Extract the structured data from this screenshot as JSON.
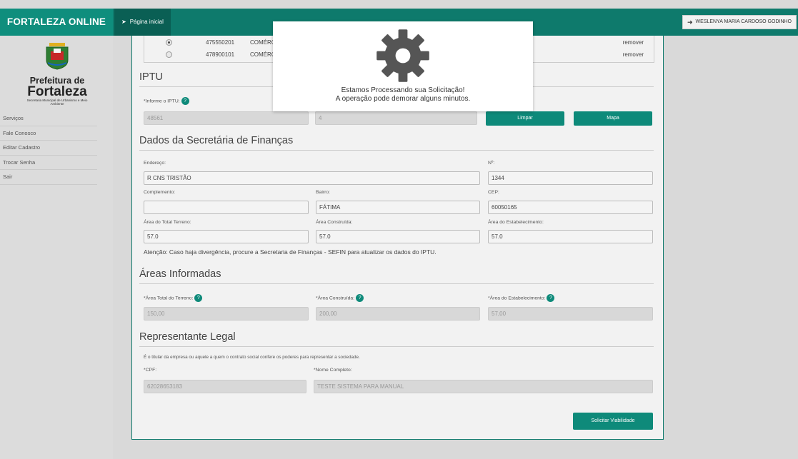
{
  "header": {
    "brand": "FORTALEZA ONLINE",
    "home_link": "Página inicial",
    "user_name": "WESLENYA MARIA CARDOSO GODINHO"
  },
  "sidebar": {
    "logo_line1": "Prefeitura de",
    "logo_line2": "Fortaleza",
    "logo_line3": "Secretaria Municipal de Urbanismo e Meio Ambiente",
    "items": [
      {
        "label": "Serviços"
      },
      {
        "label": "Fale Conosco"
      },
      {
        "label": "Editar Cadastro"
      },
      {
        "label": "Trocar Senha"
      },
      {
        "label": "Sair"
      }
    ]
  },
  "activity_rows": [
    {
      "code": "475550201",
      "desc": "COMÉRC",
      "action": "remover",
      "selected": true
    },
    {
      "code": "478900101",
      "desc": "COMÉRC",
      "action": "remover",
      "selected": false
    }
  ],
  "iptu": {
    "title": "IPTU",
    "label": "*Informe o IPTU:",
    "value": "48561",
    "second_value": "4",
    "clear_button": "Limpar",
    "map_button": "Mapa"
  },
  "finance": {
    "title": "Dados da Secretária de Finanças",
    "address_label": "Endereço:",
    "address_value": "R CNS TRISTÃO",
    "number_label": "Nº:",
    "number_value": "1344",
    "complement_label": "Complemento:",
    "complement_value": "",
    "district_label": "Bairro:",
    "district_value": "FÁTIMA",
    "cep_label": "CEP:",
    "cep_value": "60050165",
    "land_area_label": "Área do Total Terreno:",
    "land_area_value": "57.0",
    "built_area_label": "Área Construída:",
    "built_area_value": "57.0",
    "estab_area_label": "Área do Estabelecimento:",
    "estab_area_value": "57.0",
    "notice": "Atenção: Caso haja divergência, procure a Secretaria de Finanças - SEFIN para atualizar os dados do IPTU."
  },
  "informed_areas": {
    "title": "Áreas Informadas",
    "land_label": "*Área Total do Terreno:",
    "land_value": "150,00",
    "built_label": "*Área Construída:",
    "built_value": "200,00",
    "estab_label": "*Área do Estabelecimento:",
    "estab_value": "57,00"
  },
  "legal_rep": {
    "title": "Representante Legal",
    "note": "É o titular da empresa ou aquele a quem o contrato social confere os poderes para representar a sociedade.",
    "cpf_label": "*CPF:",
    "cpf_value": "62028653183",
    "name_label": "*Nome Completo:",
    "name_value": "TESTE SISTEMA PARA MANUAL"
  },
  "submit_button": "Solicitar Viabilidade",
  "modal": {
    "line1": "Estamos Processando sua Solicitação!",
    "line2": "A operação pode demorar alguns minutos."
  },
  "colors": {
    "brand": "#0e7a6c",
    "button": "#0e8a7a"
  }
}
